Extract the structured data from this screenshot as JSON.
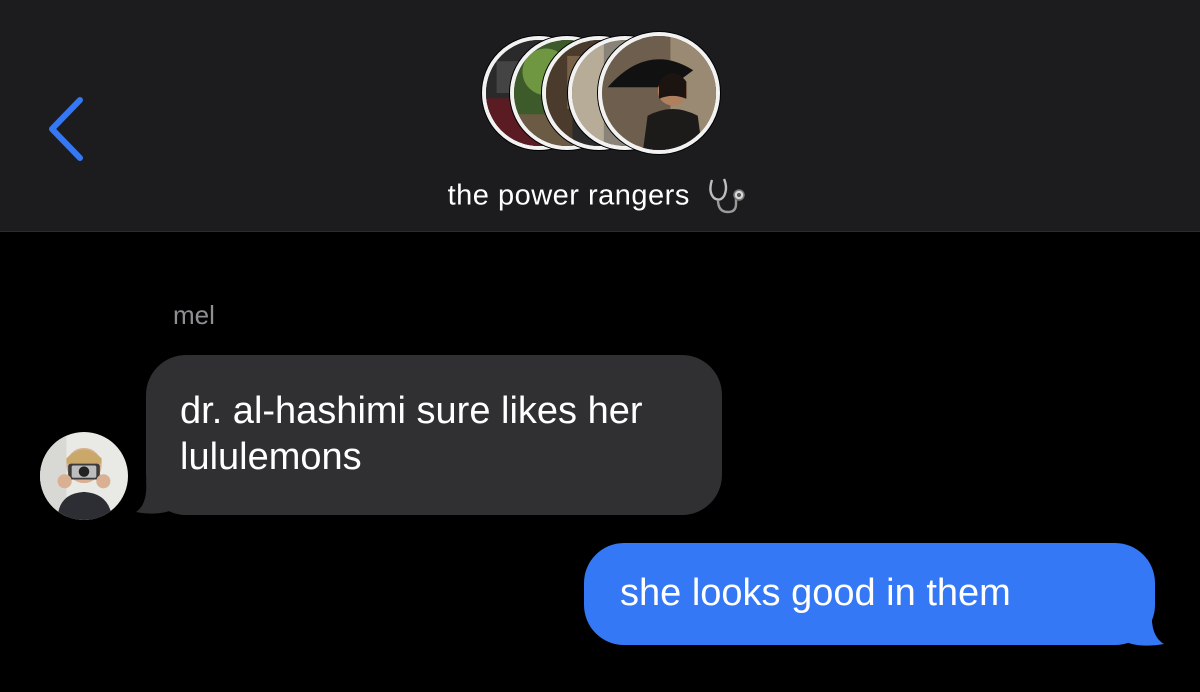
{
  "header": {
    "back_icon": "chevron-left-icon",
    "group_name": "the power rangers",
    "title_emoji": "stethoscope-icon",
    "member_avatar_count": 5,
    "accent_color": "#3478f6"
  },
  "thread": {
    "messages": [
      {
        "direction": "incoming",
        "sender": "mel",
        "text": "dr. al-hashimi sure likes her lululemons",
        "bubble_color": "#303032"
      },
      {
        "direction": "outgoing",
        "text": "she looks good in them",
        "bubble_color": "#3478f6"
      }
    ]
  }
}
